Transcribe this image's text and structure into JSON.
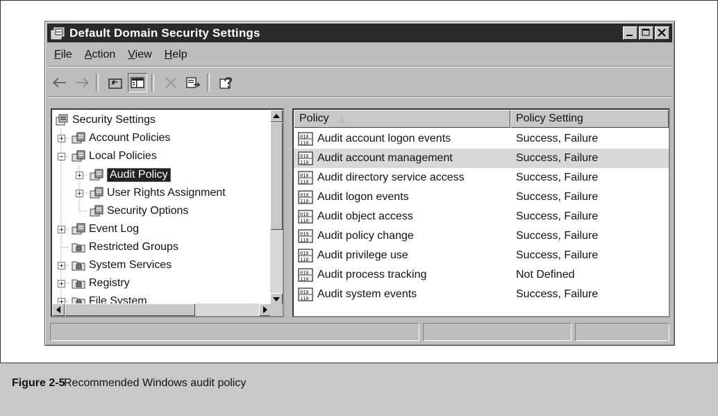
{
  "window": {
    "title": "Default Domain Security Settings",
    "controls": [
      "minimize",
      "maximize",
      "close"
    ]
  },
  "menu": [
    {
      "label": "File",
      "mnemonic": "F",
      "rest": "ile"
    },
    {
      "label": "Action",
      "mnemonic": "A",
      "rest": "ction"
    },
    {
      "label": "View",
      "mnemonic": "V",
      "rest": "iew"
    },
    {
      "label": "Help",
      "mnemonic": "H",
      "rest": "elp"
    }
  ],
  "toolbar": {
    "icons": [
      "back-arrow-icon",
      "forward-arrow-icon",
      "up-folder-icon",
      "show-hide-tree-icon",
      "delete-icon",
      "export-list-icon",
      "help-icon"
    ]
  },
  "tree": {
    "items": [
      {
        "label": "Security Settings",
        "icon": "security-settings-icon"
      },
      {
        "label": "Account Policies",
        "icon": "policy-folder-icon"
      },
      {
        "label": "Local Policies",
        "icon": "policy-folder-icon"
      },
      {
        "label": "Audit Policy",
        "icon": "policy-folder-icon",
        "selected": true
      },
      {
        "label": "User Rights Assignment",
        "icon": "policy-folder-icon"
      },
      {
        "label": "Security Options",
        "icon": "policy-folder-icon"
      },
      {
        "label": "Event Log",
        "icon": "policy-folder-icon"
      },
      {
        "label": "Restricted Groups",
        "icon": "secure-folder-icon"
      },
      {
        "label": "System Services",
        "icon": "secure-folder-icon"
      },
      {
        "label": "Registry",
        "icon": "secure-folder-icon"
      },
      {
        "label": "File System",
        "icon": "secure-folder-icon"
      }
    ]
  },
  "list": {
    "columns": [
      {
        "label": "Policy",
        "sort": "ascending"
      },
      {
        "label": "Policy Setting"
      }
    ],
    "rows": [
      {
        "policy": "Audit account logon events",
        "setting": "Success, Failure"
      },
      {
        "policy": "Audit account management",
        "setting": "Success, Failure",
        "highlighted": true
      },
      {
        "policy": "Audit directory service access",
        "setting": "Success, Failure"
      },
      {
        "policy": "Audit logon events",
        "setting": "Success, Failure"
      },
      {
        "policy": "Audit object access",
        "setting": "Success, Failure"
      },
      {
        "policy": "Audit policy change",
        "setting": "Success, Failure"
      },
      {
        "policy": "Audit privilege use",
        "setting": "Success, Failure"
      },
      {
        "policy": "Audit process tracking",
        "setting": "Not Defined"
      },
      {
        "policy": "Audit system events",
        "setting": "Success, Failure"
      }
    ]
  },
  "caption": {
    "label": "Figure 2-5",
    "text": "Recommended Windows audit policy"
  }
}
